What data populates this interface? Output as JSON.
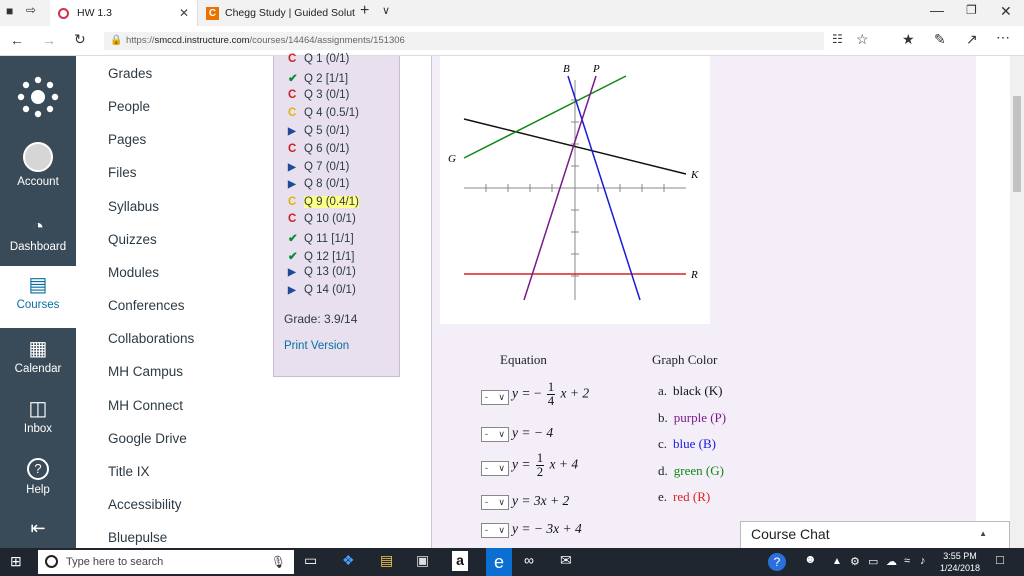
{
  "browser": {
    "tab1_title": "HW 1.3",
    "tab2_title": "Chegg Study | Guided Solut",
    "url_base": "https://",
    "url_host": "smccd.instructure.com",
    "url_path": "/courses/14464/assignments/151306",
    "chegg_letter": "C"
  },
  "global_nav": [
    {
      "label": "Account",
      "icon": "user-icon"
    },
    {
      "label": "Dashboard",
      "icon": "gauge-icon"
    },
    {
      "label": "Courses",
      "icon": "book-icon"
    },
    {
      "label": "Calendar",
      "icon": "calendar-icon"
    },
    {
      "label": "Inbox",
      "icon": "inbox-icon"
    },
    {
      "label": "Help",
      "icon": "help-icon"
    }
  ],
  "help_glyph": "?",
  "course_nav": [
    "Grades",
    "People",
    "Pages",
    "Files",
    "Syllabus",
    "Quizzes",
    "Modules",
    "Conferences",
    "Collaborations",
    "MH Campus",
    "MH Connect",
    "Google Drive",
    "Title IX",
    "Accessibility",
    "Bluepulse"
  ],
  "questions": [
    {
      "label": "Q 1 (0/1)",
      "mark": "retry"
    },
    {
      "label": "Q 2 [1/1]",
      "mark": "correct"
    },
    {
      "label": "Q 3 (0/1)",
      "mark": "retry"
    },
    {
      "label": "Q 4 (0.5/1)",
      "mark": "partial"
    },
    {
      "label": "Q 5 (0/1)",
      "mark": "unanswered"
    },
    {
      "label": "Q 6 (0/1)",
      "mark": "retry"
    },
    {
      "label": "Q 7 (0/1)",
      "mark": "unanswered"
    },
    {
      "label": "Q 8 (0/1)",
      "mark": "unanswered"
    },
    {
      "label": "Q 9 (0.4/1)",
      "mark": "partial",
      "current": true
    },
    {
      "label": "Q 10 (0/1)",
      "mark": "retry"
    },
    {
      "label": "Q 11 [1/1]",
      "mark": "correct"
    },
    {
      "label": "Q 12 [1/1]",
      "mark": "correct"
    },
    {
      "label": "Q 13 (0/1)",
      "mark": "unanswered"
    },
    {
      "label": "Q 14 (0/1)",
      "mark": "unanswered"
    }
  ],
  "grade_text": "Grade: 3.9/14",
  "print_version": "Print Version",
  "graph_labels": {
    "B": "B",
    "P": "P",
    "G": "G",
    "K": "K",
    "R": "R"
  },
  "equation_header": "Equation",
  "color_header": "Graph Color",
  "select_value": "-",
  "equations": {
    "e1": {
      "lhs": "y =",
      "sign": "−",
      "num": "1",
      "den": "4",
      "rest": "x + 2"
    },
    "e2": {
      "text": "y = − 4"
    },
    "e3": {
      "lhs": "y =",
      "num": "1",
      "den": "2",
      "rest": "x + 4"
    },
    "e4": {
      "text": "y = 3x + 2"
    },
    "e5": {
      "text": "y = − 3x + 4"
    }
  },
  "colors": [
    {
      "letter": "a.",
      "name": "black (K)",
      "color": "#111111"
    },
    {
      "letter": "b.",
      "name": "purple (P)",
      "color": "#7a1a8c"
    },
    {
      "letter": "c.",
      "name": "blue (B)",
      "color": "#1a1adc"
    },
    {
      "letter": "d.",
      "name": "green (G)",
      "color": "#118811"
    },
    {
      "letter": "e.",
      "name": "red (R)",
      "color": "#dd2222"
    }
  ],
  "course_chat": "Course Chat",
  "taskbar": {
    "search_placeholder": "Type here to search",
    "time": "3:55 PM",
    "date": "1/24/2018",
    "amazon_glyph": "a"
  }
}
